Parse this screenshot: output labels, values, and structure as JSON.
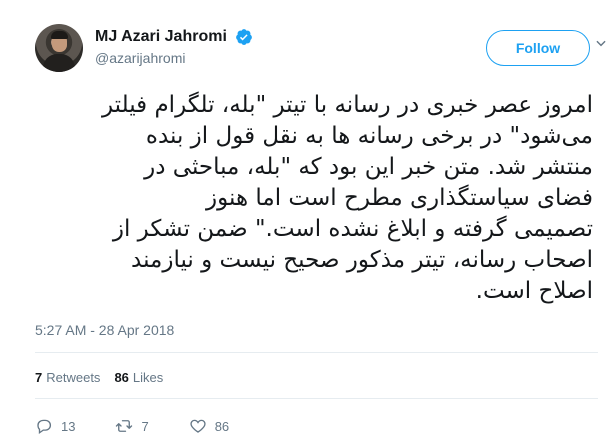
{
  "author": {
    "display_name": "MJ Azari Jahromi",
    "handle": "@azarijahromi",
    "verified": true
  },
  "follow_button": {
    "label": "Follow"
  },
  "tweet": {
    "text": "امروز عصر خبری در رسانه با تیتر \"بله، تلگرام فیلتر\nمی‌شود\" در برخی رسانه ها به نقل قول از بنده\nمنتشر شد. متن خبر این بود که \"بله، مباحثی در\nفضای سیاستگذاری مطرح است  اما هنوز\nتصمیمی گرفته و ابلاغ نشده است.\" ضمن تشکر از\nاصحاب رسانه، تیتر مذکور صحیح نیست و نیازمند\nاصلاح است.",
    "timestamp": "5:27 AM - 28 Apr 2018"
  },
  "stats": {
    "retweets_count": "7",
    "retweets_label": "Retweets",
    "likes_count": "86",
    "likes_label": "Likes"
  },
  "actions": {
    "replies": "13",
    "retweets": "7",
    "likes": "86"
  },
  "colors": {
    "accent": "#1da1f2",
    "secondary_text": "#657786",
    "divider": "#e6ecf0"
  },
  "icons": [
    "verified-badge-icon",
    "chevron-down-icon",
    "reply-icon",
    "retweet-icon",
    "heart-icon"
  ]
}
